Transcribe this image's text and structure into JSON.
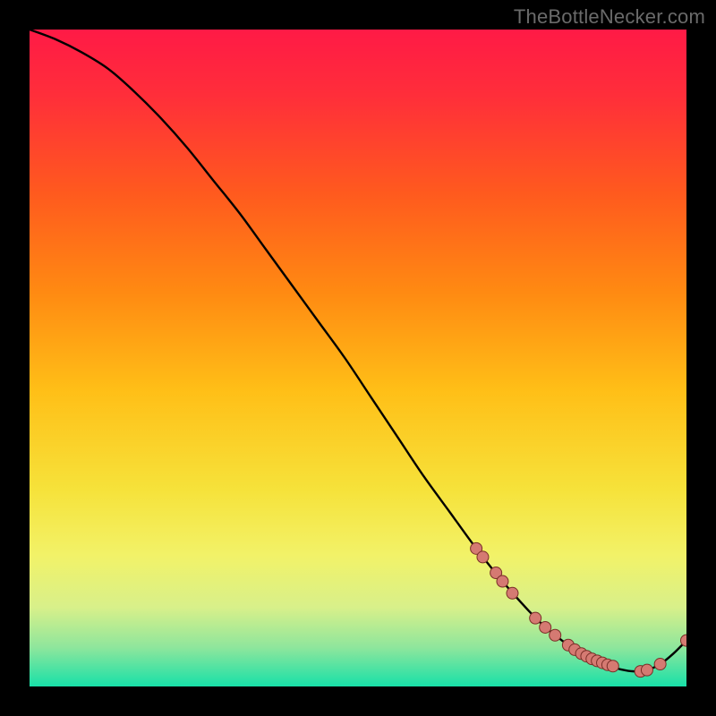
{
  "watermark": "TheBottleNecker.com",
  "colors": {
    "gradient_stops": [
      {
        "offset": 0.0,
        "color": "#ff1a46"
      },
      {
        "offset": 0.1,
        "color": "#ff2e3a"
      },
      {
        "offset": 0.25,
        "color": "#ff5a1e"
      },
      {
        "offset": 0.4,
        "color": "#ff8a12"
      },
      {
        "offset": 0.55,
        "color": "#ffbf17"
      },
      {
        "offset": 0.7,
        "color": "#f6e23a"
      },
      {
        "offset": 0.8,
        "color": "#f2f268"
      },
      {
        "offset": 0.88,
        "color": "#d8f08a"
      },
      {
        "offset": 0.94,
        "color": "#8fe69c"
      },
      {
        "offset": 1.0,
        "color": "#18e0a8"
      }
    ],
    "curve": "#000000",
    "marker_fill": "#d57a72",
    "marker_stroke": "#7a2f28"
  },
  "chart_data": {
    "type": "line",
    "title": "",
    "xlabel": "",
    "ylabel": "",
    "xlim": [
      0,
      100
    ],
    "ylim": [
      0,
      100
    ],
    "series": [
      {
        "name": "curve",
        "x": [
          0,
          4,
          8,
          12,
          16,
          20,
          24,
          28,
          32,
          36,
          40,
          44,
          48,
          52,
          56,
          60,
          64,
          68,
          72,
          76,
          78,
          80,
          82,
          84,
          86,
          88,
          90,
          92,
          94,
          96,
          98,
          100
        ],
        "y": [
          100,
          98.5,
          96.5,
          94,
          90.5,
          86.5,
          82,
          77,
          72,
          66.5,
          61,
          55.5,
          50,
          44,
          38,
          32,
          26.5,
          21,
          16,
          11.5,
          9.5,
          7.8,
          6.3,
          5.0,
          4.0,
          3.2,
          2.6,
          2.3,
          2.5,
          3.4,
          5.0,
          7.0
        ]
      }
    ],
    "markers": [
      {
        "x": 68,
        "y": 21.0
      },
      {
        "x": 69,
        "y": 19.7
      },
      {
        "x": 71,
        "y": 17.3
      },
      {
        "x": 72,
        "y": 16.0
      },
      {
        "x": 73.5,
        "y": 14.2
      },
      {
        "x": 77,
        "y": 10.4
      },
      {
        "x": 78.5,
        "y": 9.0
      },
      {
        "x": 80,
        "y": 7.8
      },
      {
        "x": 82,
        "y": 6.3
      },
      {
        "x": 83,
        "y": 5.6
      },
      {
        "x": 84,
        "y": 5.0
      },
      {
        "x": 84.8,
        "y": 4.6
      },
      {
        "x": 85.6,
        "y": 4.2
      },
      {
        "x": 86.4,
        "y": 3.9
      },
      {
        "x": 87.2,
        "y": 3.6
      },
      {
        "x": 88,
        "y": 3.3
      },
      {
        "x": 88.8,
        "y": 3.1
      },
      {
        "x": 93,
        "y": 2.3
      },
      {
        "x": 94,
        "y": 2.5
      },
      {
        "x": 96,
        "y": 3.4
      },
      {
        "x": 100,
        "y": 7.0
      }
    ]
  }
}
